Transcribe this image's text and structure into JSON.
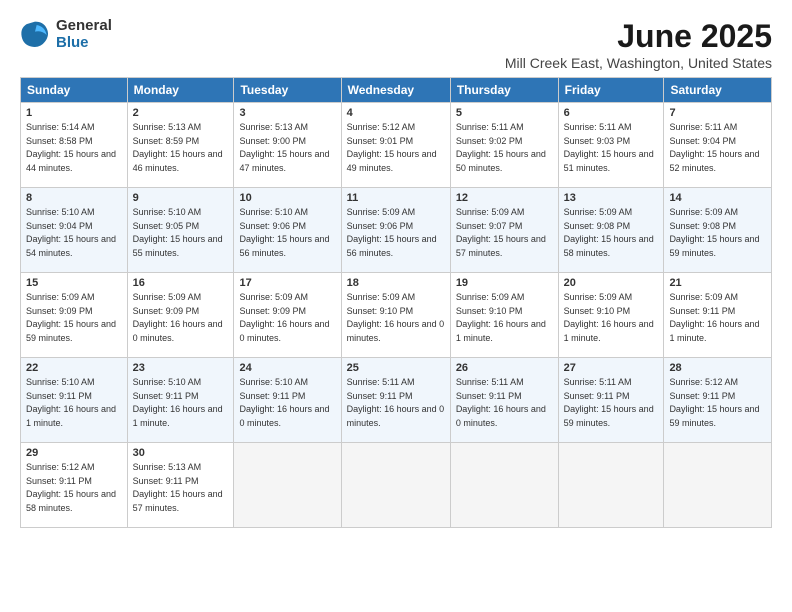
{
  "header": {
    "logo_general": "General",
    "logo_blue": "Blue",
    "main_title": "June 2025",
    "subtitle": "Mill Creek East, Washington, United States"
  },
  "calendar": {
    "days_of_week": [
      "Sunday",
      "Monday",
      "Tuesday",
      "Wednesday",
      "Thursday",
      "Friday",
      "Saturday"
    ],
    "weeks": [
      [
        {
          "day": "",
          "empty": true
        },
        {
          "day": "",
          "empty": true
        },
        {
          "day": "",
          "empty": true
        },
        {
          "day": "",
          "empty": true
        },
        {
          "day": "",
          "empty": true
        },
        {
          "day": "",
          "empty": true
        },
        {
          "day": "",
          "empty": true
        }
      ],
      [
        {
          "day": "1",
          "sunrise": "5:14 AM",
          "sunset": "8:58 PM",
          "daylight": "15 hours and 44 minutes."
        },
        {
          "day": "2",
          "sunrise": "5:13 AM",
          "sunset": "8:59 PM",
          "daylight": "15 hours and 46 minutes."
        },
        {
          "day": "3",
          "sunrise": "5:13 AM",
          "sunset": "9:00 PM",
          "daylight": "15 hours and 47 minutes."
        },
        {
          "day": "4",
          "sunrise": "5:12 AM",
          "sunset": "9:01 PM",
          "daylight": "15 hours and 49 minutes."
        },
        {
          "day": "5",
          "sunrise": "5:11 AM",
          "sunset": "9:02 PM",
          "daylight": "15 hours and 50 minutes."
        },
        {
          "day": "6",
          "sunrise": "5:11 AM",
          "sunset": "9:03 PM",
          "daylight": "15 hours and 51 minutes."
        },
        {
          "day": "7",
          "sunrise": "5:11 AM",
          "sunset": "9:04 PM",
          "daylight": "15 hours and 52 minutes."
        }
      ],
      [
        {
          "day": "8",
          "sunrise": "5:10 AM",
          "sunset": "9:04 PM",
          "daylight": "15 hours and 54 minutes."
        },
        {
          "day": "9",
          "sunrise": "5:10 AM",
          "sunset": "9:05 PM",
          "daylight": "15 hours and 55 minutes."
        },
        {
          "day": "10",
          "sunrise": "5:10 AM",
          "sunset": "9:06 PM",
          "daylight": "15 hours and 56 minutes."
        },
        {
          "day": "11",
          "sunrise": "5:09 AM",
          "sunset": "9:06 PM",
          "daylight": "15 hours and 56 minutes."
        },
        {
          "day": "12",
          "sunrise": "5:09 AM",
          "sunset": "9:07 PM",
          "daylight": "15 hours and 57 minutes."
        },
        {
          "day": "13",
          "sunrise": "5:09 AM",
          "sunset": "9:08 PM",
          "daylight": "15 hours and 58 minutes."
        },
        {
          "day": "14",
          "sunrise": "5:09 AM",
          "sunset": "9:08 PM",
          "daylight": "15 hours and 59 minutes."
        }
      ],
      [
        {
          "day": "15",
          "sunrise": "5:09 AM",
          "sunset": "9:09 PM",
          "daylight": "15 hours and 59 minutes."
        },
        {
          "day": "16",
          "sunrise": "5:09 AM",
          "sunset": "9:09 PM",
          "daylight": "16 hours and 0 minutes."
        },
        {
          "day": "17",
          "sunrise": "5:09 AM",
          "sunset": "9:09 PM",
          "daylight": "16 hours and 0 minutes."
        },
        {
          "day": "18",
          "sunrise": "5:09 AM",
          "sunset": "9:10 PM",
          "daylight": "16 hours and 0 minutes."
        },
        {
          "day": "19",
          "sunrise": "5:09 AM",
          "sunset": "9:10 PM",
          "daylight": "16 hours and 1 minute."
        },
        {
          "day": "20",
          "sunrise": "5:09 AM",
          "sunset": "9:10 PM",
          "daylight": "16 hours and 1 minute."
        },
        {
          "day": "21",
          "sunrise": "5:09 AM",
          "sunset": "9:11 PM",
          "daylight": "16 hours and 1 minute."
        }
      ],
      [
        {
          "day": "22",
          "sunrise": "5:10 AM",
          "sunset": "9:11 PM",
          "daylight": "16 hours and 1 minute."
        },
        {
          "day": "23",
          "sunrise": "5:10 AM",
          "sunset": "9:11 PM",
          "daylight": "16 hours and 1 minute."
        },
        {
          "day": "24",
          "sunrise": "5:10 AM",
          "sunset": "9:11 PM",
          "daylight": "16 hours and 0 minutes."
        },
        {
          "day": "25",
          "sunrise": "5:11 AM",
          "sunset": "9:11 PM",
          "daylight": "16 hours and 0 minutes."
        },
        {
          "day": "26",
          "sunrise": "5:11 AM",
          "sunset": "9:11 PM",
          "daylight": "16 hours and 0 minutes."
        },
        {
          "day": "27",
          "sunrise": "5:11 AM",
          "sunset": "9:11 PM",
          "daylight": "15 hours and 59 minutes."
        },
        {
          "day": "28",
          "sunrise": "5:12 AM",
          "sunset": "9:11 PM",
          "daylight": "15 hours and 59 minutes."
        }
      ],
      [
        {
          "day": "29",
          "sunrise": "5:12 AM",
          "sunset": "9:11 PM",
          "daylight": "15 hours and 58 minutes."
        },
        {
          "day": "30",
          "sunrise": "5:13 AM",
          "sunset": "9:11 PM",
          "daylight": "15 hours and 57 minutes."
        },
        {
          "day": "",
          "empty": true
        },
        {
          "day": "",
          "empty": true
        },
        {
          "day": "",
          "empty": true
        },
        {
          "day": "",
          "empty": true
        },
        {
          "day": "",
          "empty": true
        }
      ]
    ]
  }
}
